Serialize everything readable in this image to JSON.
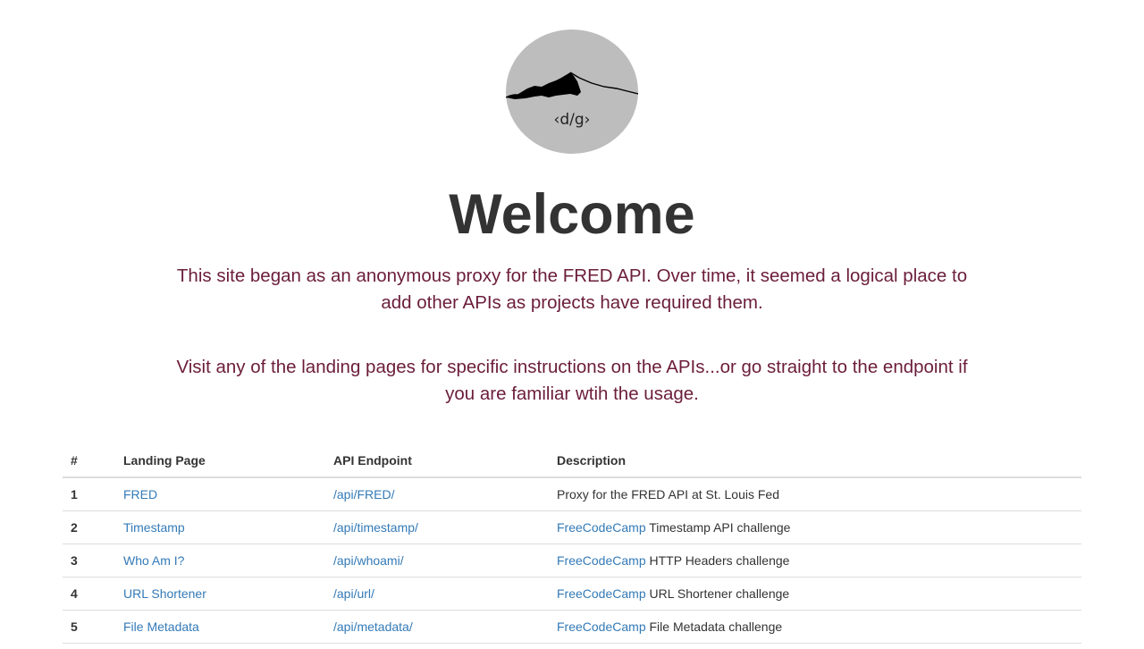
{
  "logo": {
    "text": "‹d/g›",
    "bg_color": "#bdbdbd"
  },
  "header": {
    "title": "Welcome"
  },
  "intro": {
    "paragraph1": "This site began as an anonymous proxy for the FRED API. Over time, it seemed a logical place to add other APIs as projects have required them.",
    "paragraph2": "Visit any of the landing pages for specific instructions on the APIs...or go straight to the endpoint if you are familiar wtih the usage."
  },
  "table": {
    "headers": {
      "num": "#",
      "landing": "Landing Page",
      "endpoint": "API Endpoint",
      "description": "Description"
    },
    "rows": [
      {
        "num": "1",
        "landing": "FRED",
        "endpoint": "/api/FRED/",
        "desc_link": "",
        "desc_text": "Proxy for the FRED API at St. Louis Fed"
      },
      {
        "num": "2",
        "landing": "Timestamp",
        "endpoint": "/api/timestamp/",
        "desc_link": "FreeCodeCamp",
        "desc_text": " Timestamp API challenge"
      },
      {
        "num": "3",
        "landing": "Who Am I?",
        "endpoint": "/api/whoami/",
        "desc_link": "FreeCodeCamp",
        "desc_text": " HTTP Headers challenge"
      },
      {
        "num": "4",
        "landing": "URL Shortener",
        "endpoint": "/api/url/",
        "desc_link": "FreeCodeCamp",
        "desc_text": " URL Shortener challenge"
      },
      {
        "num": "5",
        "landing": "File Metadata",
        "endpoint": "/api/metadata/",
        "desc_link": "FreeCodeCamp",
        "desc_text": " File Metadata challenge"
      }
    ]
  },
  "colors": {
    "link": "#337ab7",
    "lead_text": "#6b1d3a",
    "heading": "#333333"
  }
}
